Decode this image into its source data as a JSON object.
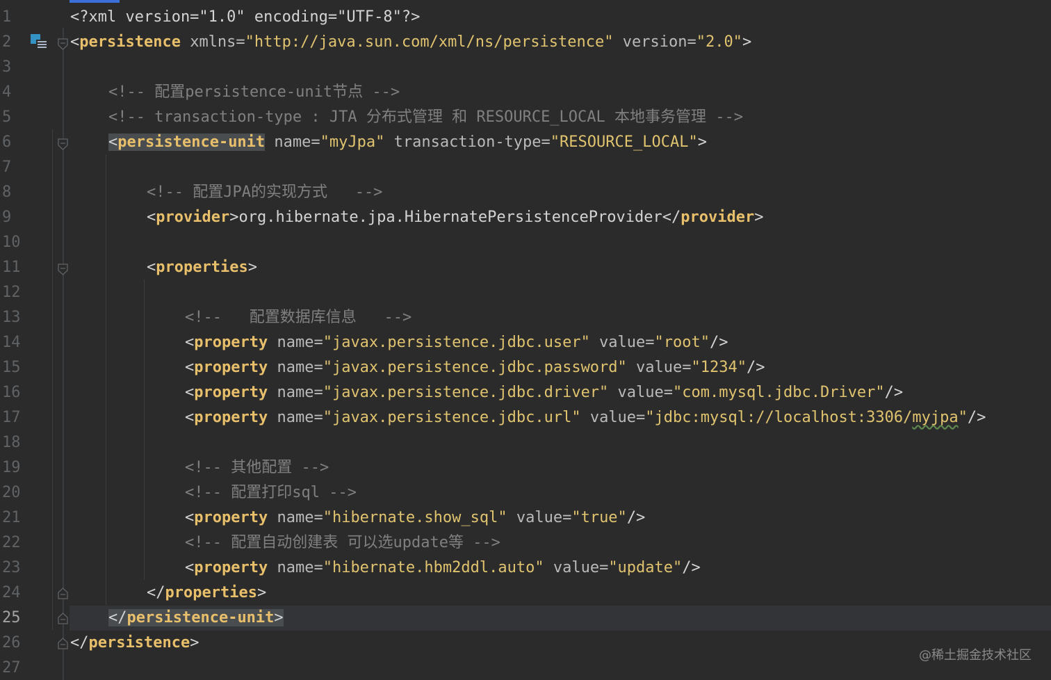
{
  "editor": {
    "line_numbers": [
      "1",
      "2",
      "3",
      "4",
      "5",
      "6",
      "7",
      "8",
      "9",
      "10",
      "11",
      "12",
      "13",
      "14",
      "15",
      "16",
      "17",
      "18",
      "19",
      "20",
      "21",
      "22",
      "23",
      "24",
      "25",
      "26",
      "27"
    ],
    "active_line": "25",
    "colors": {
      "tag": "#e8bf6a",
      "attribute": "#bababa",
      "string": "#e0c36f",
      "comment": "#808080",
      "background": "#2b2b2b"
    }
  },
  "code": {
    "l1": "<?xml version=\"1.0\" encoding=\"UTF-8\"?>",
    "l2": {
      "open": "<",
      "tag": "persistence",
      "attr1": " xmlns=",
      "val1": "\"http://java.sun.com/xml/ns/persistence\"",
      "attr2": " version=",
      "val2": "\"2.0\"",
      "close": ">"
    },
    "l4": "<!-- 配置persistence-unit节点 -->",
    "l5": "<!-- transaction-type : JTA 分布式管理 和 RESOURCE_LOCAL 本地事务管理 -->",
    "l6": {
      "open": "<",
      "tag": "persistence-unit",
      "attr1": " name=",
      "val1": "\"myJpa\"",
      "attr2": " transaction-type=",
      "val2": "\"RESOURCE_LOCAL\"",
      "close": ">"
    },
    "l8": "<!-- 配置JPA的实现方式   -->",
    "l9": {
      "open": "<",
      "tag": "provider",
      "mid": ">org.hibernate.jpa.HibernatePersistenceProvider</",
      "tag2": "provider",
      "close": ">"
    },
    "l11": {
      "open": "<",
      "tag": "properties",
      "close": ">"
    },
    "l13": "<!--   配置数据库信息   -->",
    "l14": {
      "tag": "property",
      "name": "\"javax.persistence.jdbc.user\"",
      "value": "\"root\""
    },
    "l15": {
      "tag": "property",
      "name": "\"javax.persistence.jdbc.password\"",
      "value": "\"1234\""
    },
    "l16": {
      "tag": "property",
      "name": "\"javax.persistence.jdbc.driver\"",
      "value": "\"com.mysql.jdbc.Driver\""
    },
    "l17": {
      "tag": "property",
      "name": "\"javax.persistence.jdbc.url\"",
      "value_a": "\"jdbc:mysql://localhost:3306/",
      "value_b": "myjpa",
      "value_c": "\""
    },
    "l19": "<!-- 其他配置 -->",
    "l20": "<!-- 配置打印sql -->",
    "l21": {
      "tag": "property",
      "name": "\"hibernate.show_sql\"",
      "value": "\"true\""
    },
    "l22": "<!-- 配置自动创建表 可以选update等 -->",
    "l23": {
      "tag": "property",
      "name": "\"hibernate.hbm2ddl.auto\"",
      "value": "\"update\""
    },
    "l24": {
      "tag": "properties"
    },
    "l25": {
      "tag": "persistence-unit"
    },
    "l26": {
      "tag": "persistence"
    },
    "attr_name": " name=",
    "attr_value": " value=",
    "lt": "<",
    "gt": ">",
    "lt_slash": "</",
    "self_close": "/>"
  },
  "watermark": "@稀土掘金技术社区"
}
